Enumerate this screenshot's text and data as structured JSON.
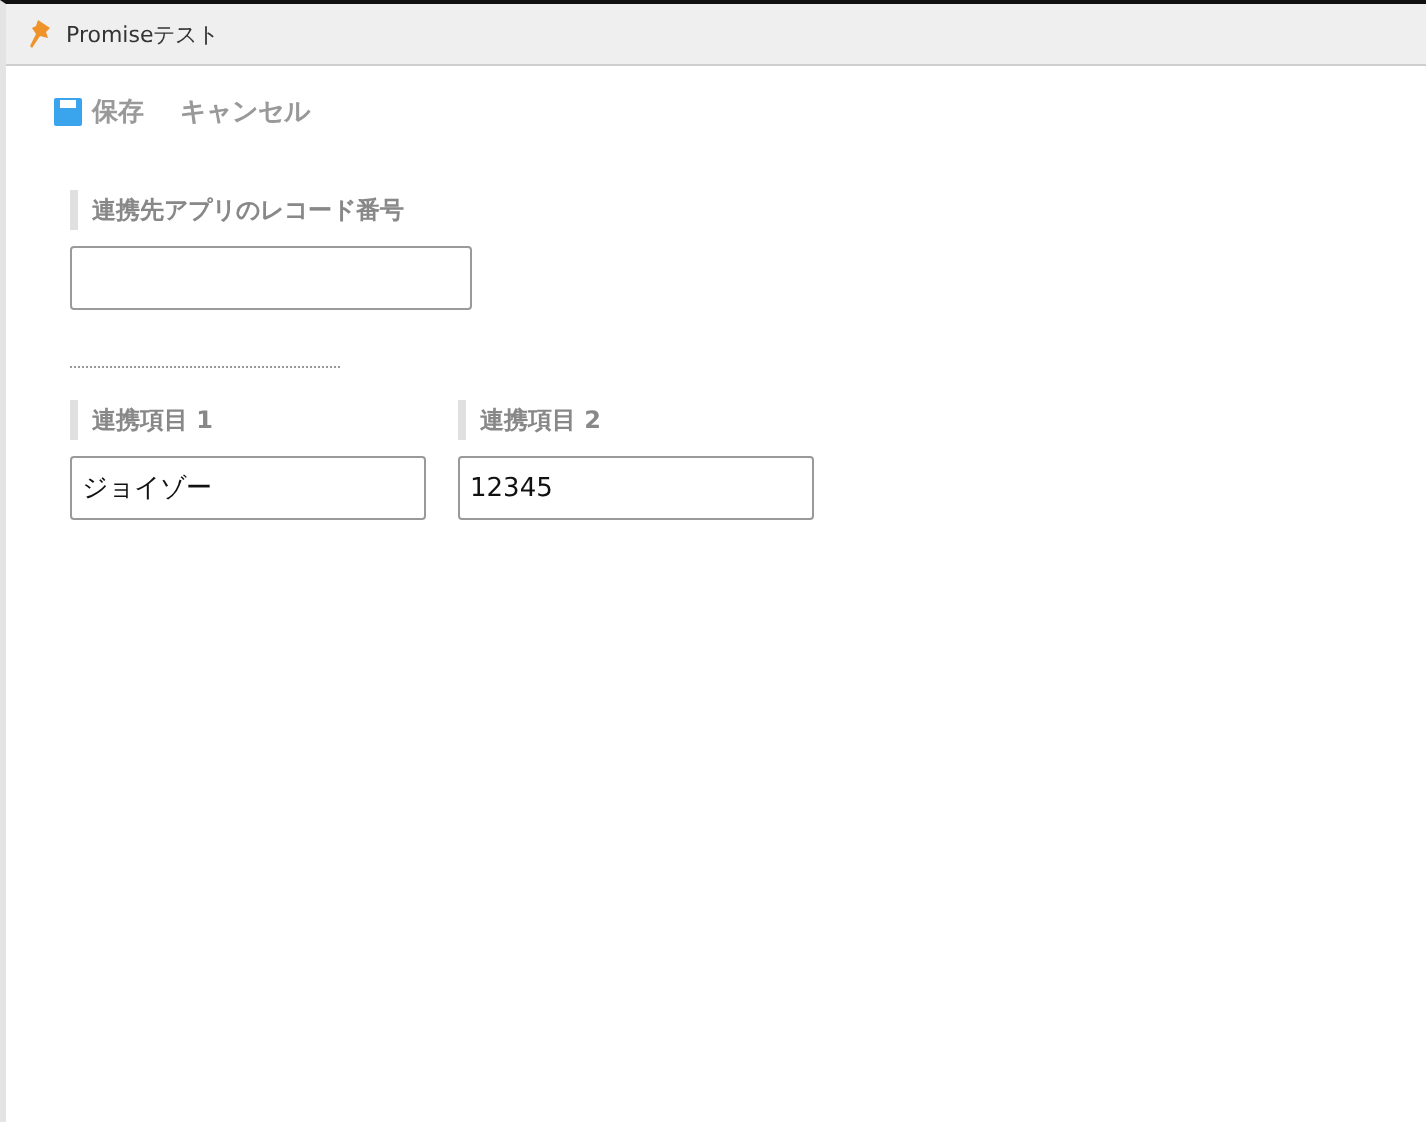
{
  "window": {
    "title": "Promiseテスト"
  },
  "toolbar": {
    "save": "保存",
    "cancel": "キャンセル"
  },
  "record_field": {
    "label": "連携先アプリのレコード番号"
  },
  "linked_fields": [
    {
      "label": "連携項目 1",
      "value": "ジョイゾー"
    },
    {
      "label": "連携項目 2",
      "value": "12345"
    }
  ]
}
